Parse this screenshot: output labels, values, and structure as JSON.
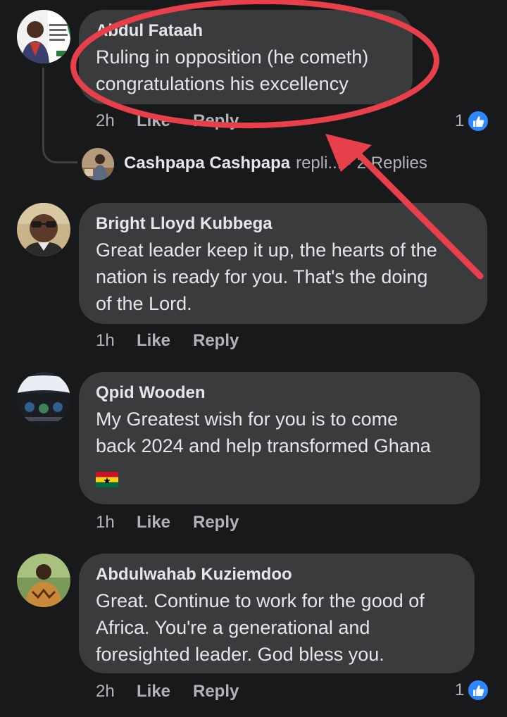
{
  "comments": [
    {
      "author": "Abdul Fataah",
      "text_lines": [
        "Ruling in opposition (he cometh)",
        "congratulations his excellency"
      ],
      "time": "2h",
      "like_label": "Like",
      "reply_label": "Reply",
      "reaction_count": "1"
    },
    {
      "author": "Bright Lloyd Kubbega",
      "text_lines": [
        "Great leader keep it up, the hearts of the",
        "nation is ready for you. That's the doing",
        "of the Lord."
      ],
      "time": "1h",
      "like_label": "Like",
      "reply_label": "Reply"
    },
    {
      "author": "Qpid Wooden",
      "text_lines": [
        "My Greatest wish for you is to come",
        "back 2024 and help transformed Ghana"
      ],
      "emoji": "ghana-flag",
      "time": "1h",
      "like_label": "Like",
      "reply_label": "Reply"
    },
    {
      "author": "Abdulwahab Kuziemdoo",
      "text_lines": [
        "Great. Continue to work for the good of",
        "Africa. You're a generational and",
        "foresighted leader. God bless you."
      ],
      "time": "2h",
      "like_label": "Like",
      "reply_label": "Reply",
      "reaction_count": "1"
    }
  ],
  "reply_thread": {
    "name": "Cashpapa Cashpapa",
    "rest": "repli... · 2 Replies"
  },
  "colors": {
    "background": "#18191a",
    "bubble": "#3a3b3c",
    "annotation": "#e8404a",
    "like_blue": "#2d88ff"
  }
}
